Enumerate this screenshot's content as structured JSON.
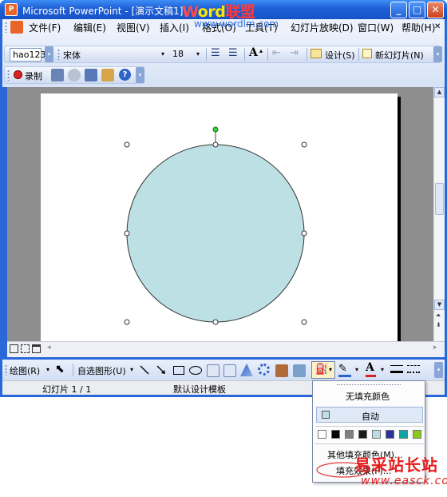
{
  "window": {
    "title": "Microsoft PowerPoint - [演示文稿1]",
    "buttons": {
      "minimize": "_",
      "maximize": "□",
      "close": "✕"
    }
  },
  "watermark_top": {
    "part1": "W",
    "part2": "ord",
    "part3": "联盟",
    "url": "www.wordlm.com"
  },
  "menubar": {
    "items": [
      {
        "label": "文件(F)",
        "icon": "powerpoint-icon"
      },
      {
        "label": "编辑(E)"
      },
      {
        "label": "视图(V)"
      },
      {
        "label": "插入(I)"
      },
      {
        "label": "格式(O)"
      },
      {
        "label": "工具(T)"
      },
      {
        "label": "幻灯片放映(D)"
      },
      {
        "label": "窗口(W)"
      },
      {
        "label": "帮助(H)"
      }
    ],
    "close_doc": "✕"
  },
  "formatting_toolbar": {
    "style_box": "hao123",
    "font_name": "宋体",
    "font_size": "18",
    "grow_font": "A",
    "design_label": "设计(S)",
    "new_slide_label": "新幻灯片(N)"
  },
  "secondary_toolbar": {
    "record_label": "录制"
  },
  "drawing_toolbar": {
    "draw_label": "绘图(R)",
    "autoshapes_label": "自选图形(U)",
    "font_color_letter": "A",
    "colors": {
      "line": "#2a62c9",
      "font": "#d81e1e"
    }
  },
  "statusbar": {
    "slide_info": "幻灯片 1 / 1",
    "template": "默认设计模板"
  },
  "fill_menu": {
    "no_fill": "无填充颜色",
    "automatic": "自动",
    "more_colors": "其他填充颜色(M)...",
    "fill_effects": "填充效果(F)...",
    "swatches": [
      "#ffffff",
      "#000000",
      "#808080",
      "#1a1a1a",
      "#b9dde4",
      "#2b3496",
      "#11a3a3",
      "#8cc71e"
    ]
  },
  "shape": {
    "type": "circle",
    "fill_color": "#bde0e5",
    "line_color": "#333333"
  },
  "watermark_bottom": {
    "cn": "易采站长站",
    "url": "www.easck.com"
  }
}
